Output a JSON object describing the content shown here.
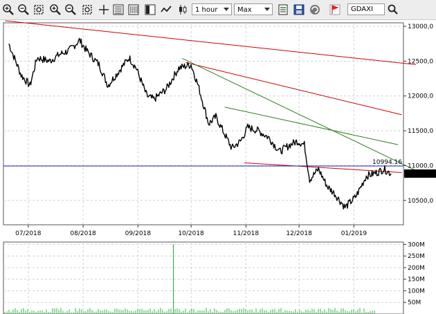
{
  "toolbar": {
    "timeframe": "1 hour",
    "range": "Max",
    "symbol": "GDAXI",
    "icons": [
      "zoom-in-icon",
      "zoom-out-icon",
      "zoom-fit-icon",
      "zoom-in-alt-icon",
      "zoom-out-alt-icon",
      "zoom-fit-alt-icon",
      "crosshair-icon",
      "bar-chart-icon",
      "ohlc-bars-icon",
      "line-chart-icon",
      "candlestick-icon",
      "indicator-list-icon",
      "save-icon",
      "refresh-icon",
      "alert-flag-icon",
      "search-icon"
    ]
  },
  "price_panel": {
    "y_ticks": [
      "13000,0",
      "12500,0",
      "12000,0",
      "11500,0",
      "11000,0",
      "10500,0"
    ],
    "x_ticks": [
      "07/2018",
      "08/2018",
      "09/2018",
      "10/2018",
      "11/2018",
      "12/2018",
      "01/2019"
    ],
    "horizontal_line_label": "10994.16",
    "last_price_label": "10885,4"
  },
  "volume_panel": {
    "y_ticks": [
      "300M",
      "250M",
      "200M",
      "150M",
      "100M",
      "50M"
    ]
  },
  "colors": {
    "price_line": "#000000",
    "red_trend": "#cc0000",
    "green_trend": "#2e7d1f",
    "horizontal_line": "#1a1acc",
    "volume_bars": "#36b04a",
    "grid": "#d0d0d0"
  },
  "chart_data": [
    {
      "type": "line",
      "series": [
        {
          "values": [
            {
              "x": "2018-06-20",
              "y": 12750
            },
            {
              "x": "2018-06-27",
              "y": 12300
            },
            {
              "x": "2018-07-02",
              "y": 12150
            },
            {
              "x": "2018-07-06",
              "y": 12550
            },
            {
              "x": "2018-07-13",
              "y": 12500
            },
            {
              "x": "2018-07-19",
              "y": 12600
            },
            {
              "x": "2018-07-24",
              "y": 12650
            },
            {
              "x": "2018-07-30",
              "y": 12800
            },
            {
              "x": "2018-08-03",
              "y": 12650
            },
            {
              "x": "2018-08-10",
              "y": 12450
            },
            {
              "x": "2018-08-15",
              "y": 12150
            },
            {
              "x": "2018-08-21",
              "y": 12350
            },
            {
              "x": "2018-08-27",
              "y": 12550
            },
            {
              "x": "2018-08-31",
              "y": 12400
            },
            {
              "x": "2018-09-06",
              "y": 12000
            },
            {
              "x": "2018-09-10",
              "y": 11950
            },
            {
              "x": "2018-09-17",
              "y": 12100
            },
            {
              "x": "2018-09-24",
              "y": 12400
            },
            {
              "x": "2018-10-01",
              "y": 12450
            },
            {
              "x": "2018-10-05",
              "y": 12150
            },
            {
              "x": "2018-10-11",
              "y": 11600
            },
            {
              "x": "2018-10-15",
              "y": 11700
            },
            {
              "x": "2018-10-19",
              "y": 11500
            },
            {
              "x": "2018-10-24",
              "y": 11250
            },
            {
              "x": "2018-10-29",
              "y": 11350
            },
            {
              "x": "2018-11-02",
              "y": 11550
            },
            {
              "x": "2018-11-08",
              "y": 11500
            },
            {
              "x": "2018-11-14",
              "y": 11400
            },
            {
              "x": "2018-11-20",
              "y": 11200
            },
            {
              "x": "2018-11-26",
              "y": 11300
            },
            {
              "x": "2018-11-30",
              "y": 11350
            },
            {
              "x": "2018-12-04",
              "y": 11300
            },
            {
              "x": "2018-12-07",
              "y": 10800
            },
            {
              "x": "2018-12-12",
              "y": 10950
            },
            {
              "x": "2018-12-17",
              "y": 10700
            },
            {
              "x": "2018-12-21",
              "y": 10600
            },
            {
              "x": "2018-12-27",
              "y": 10400
            },
            {
              "x": "2019-01-02",
              "y": 10550
            },
            {
              "x": "2019-01-08",
              "y": 10850
            },
            {
              "x": "2019-01-14",
              "y": 10900
            },
            {
              "x": "2019-01-18",
              "y": 10950
            },
            {
              "x": "2019-01-22",
              "y": 10885
            }
          ]
        }
      ],
      "trendlines": [
        {
          "color": "red",
          "from": {
            "x": "2018-06-18",
            "y": 13080
          },
          "to": {
            "x": "2019-02-05",
            "y": 12450
          }
        },
        {
          "color": "red",
          "from": {
            "x": "2018-09-28",
            "y": 12480
          },
          "to": {
            "x": "2019-01-28",
            "y": 11730
          }
        },
        {
          "color": "green",
          "from": {
            "x": "2018-09-26",
            "y": 12540
          },
          "to": {
            "x": "2019-02-05",
            "y": 10930
          }
        },
        {
          "color": "green",
          "from": {
            "x": "2018-10-20",
            "y": 11840
          },
          "to": {
            "x": "2019-01-26",
            "y": 11300
          }
        },
        {
          "color": "red",
          "from": {
            "x": "2018-10-31",
            "y": 11040
          },
          "to": {
            "x": "2019-01-28",
            "y": 10900
          }
        }
      ],
      "horizontal_line": 10994.16,
      "ylim": [
        10150,
        13050
      ],
      "xlim": [
        "2018-06-17",
        "2019-01-29"
      ],
      "grid": true
    },
    {
      "type": "bar",
      "name": "volume",
      "ylim": [
        0,
        310000000
      ],
      "spike": {
        "x": "2018-09-21",
        "y": 300000000
      },
      "baseline_level": 25000000,
      "grid": true
    }
  ]
}
